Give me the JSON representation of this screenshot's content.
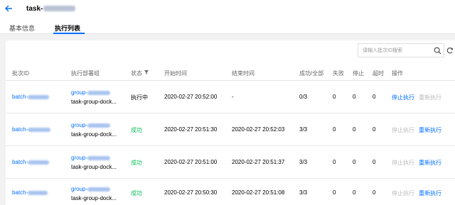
{
  "header": {
    "title_prefix": "task-",
    "back_icon": "arrow-left-icon"
  },
  "tabs": [
    {
      "label": "基本信息"
    },
    {
      "label": "执行列表"
    }
  ],
  "search": {
    "placeholder": "请输入批次ID搜索"
  },
  "table": {
    "columns": [
      "批次ID",
      "执行部署组",
      "状态",
      "开始时间",
      "结束时间",
      "成功/全部",
      "失败",
      "停止",
      "超时",
      "操作"
    ],
    "rows": [
      {
        "batch_prefix": "batch-",
        "group_prefix": "group-",
        "group_name": "task-group-dock...",
        "status": "执行中",
        "status_type": "running",
        "start": "2020-02-27 20:52:00",
        "end": "-",
        "success": "0/3",
        "fail": "0",
        "stop": "0",
        "timeout": "0",
        "action_stop": "停止执行",
        "action_rerun": "重新执行",
        "stop_enabled": true,
        "rerun_enabled": false
      },
      {
        "batch_prefix": "batch-",
        "group_prefix": "group-",
        "group_name": "task-group-dock...",
        "status": "成功",
        "status_type": "success",
        "start": "2020-02-27 20:51:30",
        "end": "2020-02-27 20:52:03",
        "success": "3/3",
        "fail": "0",
        "stop": "0",
        "timeout": "0",
        "action_stop": "停止执行",
        "action_rerun": "重新执行",
        "stop_enabled": false,
        "rerun_enabled": true
      },
      {
        "batch_prefix": "batch-",
        "group_prefix": "group-",
        "group_name": "task-group-dock...",
        "status": "成功",
        "status_type": "success",
        "start": "2020-02-27 20:51:00",
        "end": "2020-02-27 20:51:37",
        "success": "3/3",
        "fail": "0",
        "stop": "0",
        "timeout": "0",
        "action_stop": "停止执行",
        "action_rerun": "重新执行",
        "stop_enabled": false,
        "rerun_enabled": true
      },
      {
        "batch_prefix": "batch-",
        "group_prefix": "group-",
        "group_name": "task-group-dock...",
        "status": "成功",
        "status_type": "success",
        "start": "2020-02-27 20:50:30",
        "end": "2020-02-27 20:51:08",
        "success": "3/3",
        "fail": "0",
        "stop": "0",
        "timeout": "0",
        "action_stop": "停止执行",
        "action_rerun": "重新执行",
        "stop_enabled": false,
        "rerun_enabled": true
      }
    ]
  },
  "colors": {
    "accent": "#006eff",
    "success": "#0abf5b",
    "disabled": "#bbbbbb"
  }
}
